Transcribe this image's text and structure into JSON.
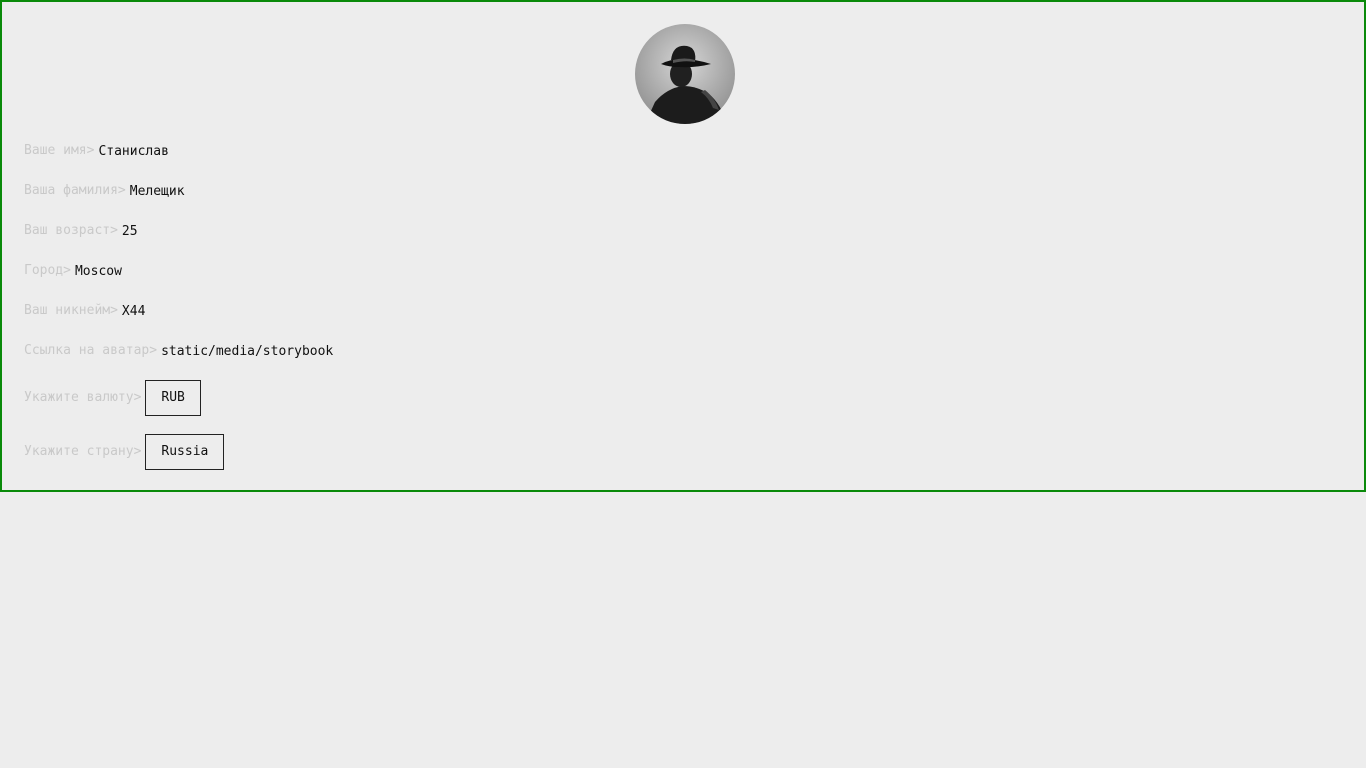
{
  "profile": {
    "avatar_icon": "user-avatar-silhouette-icon",
    "fields": {
      "first_name": {
        "label": "Ваше имя>",
        "value": "Станислав"
      },
      "last_name": {
        "label": "Ваша фамилия>",
        "value": "Мелещик"
      },
      "age": {
        "label": "Ваш возраст>",
        "value": "25"
      },
      "city": {
        "label": "Город>",
        "value": "Moscow"
      },
      "nickname": {
        "label": "Ваш никнейм>",
        "value": "X44"
      },
      "avatar_link": {
        "label": "Ссылка на аватар>",
        "value": "static/media/storybook"
      }
    },
    "currency": {
      "label": "Укажите валюту>",
      "selected": "RUB"
    },
    "country": {
      "label": "Укажите страну>",
      "selected": "Russia"
    }
  },
  "colors": {
    "border": "#0a8a0a",
    "background": "#ededed",
    "label": "#c9c9c9",
    "value": "#111111"
  }
}
